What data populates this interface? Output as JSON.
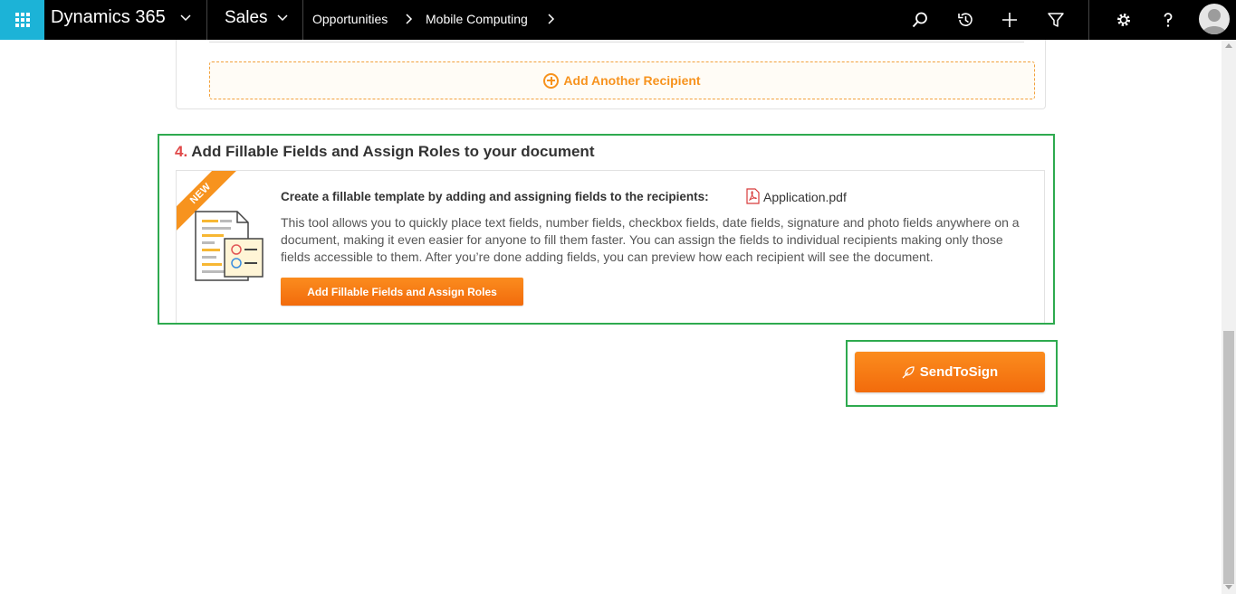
{
  "topbar": {
    "brand": "Dynamics 365",
    "app": "Sales",
    "breadcrumb": [
      "Opportunities",
      "Mobile Computing"
    ],
    "icons": [
      "search-icon",
      "history-icon",
      "plus-icon",
      "filter-icon",
      "gear-icon",
      "help-icon",
      "user-avatar-icon"
    ],
    "brand_color": "#1cb3d7"
  },
  "recipients": {
    "add_another_label": "Add Another Recipient"
  },
  "step4": {
    "number": "4.",
    "title": "Add Fillable Fields and Assign Roles to your document",
    "badge": "NEW",
    "heading": "Create a fillable template by adding and assigning fields to the recipients:",
    "file_name": "Application.pdf",
    "description": "This tool allows you to quickly place text fields, number fields, checkbox fields, date fields, signature and photo fields anywhere on a document, making it even easier for anyone to fill them faster. You can assign the fields to individual recipients making only those fields accessible to them. After you’re done adding fields, you can preview how each recipient will see the document.",
    "button_label": "Add Fillable Fields and Assign Roles"
  },
  "send": {
    "button_label": "SendToSign"
  },
  "colors": {
    "accent_orange": "#f7931e",
    "highlight_green": "#2eaa4f",
    "step_number_red": "#e04848"
  }
}
